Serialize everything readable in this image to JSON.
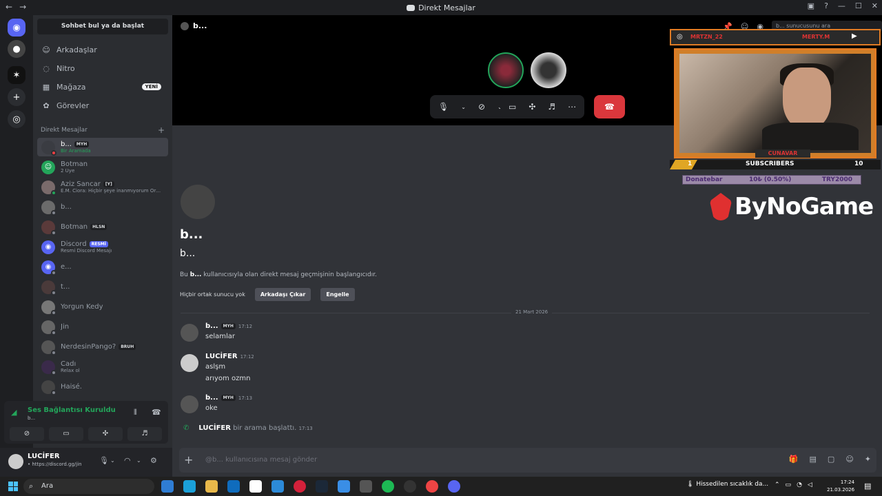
{
  "window": {
    "title": "Direkt Mesajlar"
  },
  "sidebar": {
    "search_label": "Sohbet bul ya da başlat",
    "nav": [
      {
        "label": "Arkadaşlar",
        "icon": "friends-icon"
      },
      {
        "label": "Nitro",
        "icon": "nitro-icon"
      },
      {
        "label": "Mağaza",
        "icon": "shop-icon",
        "badge": "YENİ"
      },
      {
        "label": "Görevler",
        "icon": "quests-icon"
      }
    ],
    "dm_header": "Direkt Mesajlar",
    "dms": [
      {
        "name": "b...",
        "tag": "MYH",
        "sub": "Bir Aramada"
      },
      {
        "name": "Botman",
        "sub": "2 Üye"
      },
      {
        "name": "Aziz Sancar",
        "tag": "[Y]",
        "sub": "E.M. Ciora: Hiçbir şeye inanmıyorum Orma..."
      },
      {
        "name": "b..."
      },
      {
        "name": "Botman",
        "tag": "HLSN"
      },
      {
        "name": "Discord",
        "tag": "RESMİ",
        "sub": "Resmi Discord Mesajı"
      },
      {
        "name": "e..."
      },
      {
        "name": "t..."
      },
      {
        "name": "Yorgun Kedy"
      },
      {
        "name": "Jin"
      },
      {
        "name": "NerdesinPango?",
        "tag": "BRUH"
      },
      {
        "name": "Cadı",
        "sub": "Relax ol"
      },
      {
        "name": "Haisé."
      }
    ]
  },
  "voice": {
    "status": "Ses Bağlantısı Kuruldu",
    "channel": "b..."
  },
  "user": {
    "name": "LUCİFER",
    "status": "• https://discord.gg/jin"
  },
  "call": {
    "channel_title": "b...",
    "search_placeholder": "b... sunucusunu ara"
  },
  "intro": {
    "title": "b...",
    "subtitle": "b...",
    "desc_prefix": "Bu ",
    "desc_name": "b...",
    "desc_suffix": " kullanıcısıyla olan direkt mesaj geçmişinin başlangıcıdır.",
    "no_mutual": "Hiçbir ortak sunucu yok",
    "remove_friend": "Arkadaşı Çıkar",
    "block": "Engelle"
  },
  "date_divider": "21 Mart 2026",
  "messages": [
    {
      "author": "b...",
      "tag": "MYH",
      "time": "17:12",
      "lines": [
        "selamlar"
      ]
    },
    {
      "author": "LUCİFER",
      "time": "17:12",
      "lines": [
        "aslşm",
        "arıyom ozmn"
      ]
    },
    {
      "author": "b...",
      "tag": "MYH",
      "time": "17:13",
      "lines": [
        "oke"
      ]
    }
  ],
  "system_message": {
    "author": "LUCİFER",
    "text": "bir arama başlattı.",
    "time": "17:13"
  },
  "composer": {
    "placeholder": "@b... kullanıcısına mesaj gönder"
  },
  "overlay": {
    "instagram": "MRTZN_22",
    "youtube": "MERTY.M",
    "cam_label": "CUNAVAR",
    "sub_left": "1",
    "sub_label": "SUBSCRIBERS",
    "sub_right": "10",
    "donate_left": "Donatebar",
    "donate_center": "10₺ (0.50%)",
    "donate_right": "TRY2000",
    "brand": "ByNoGame"
  },
  "taskbar": {
    "search": "Ara",
    "weather": "Hissedilen sıcaklık da...",
    "time": "17:24",
    "date": "21.03.2026"
  }
}
